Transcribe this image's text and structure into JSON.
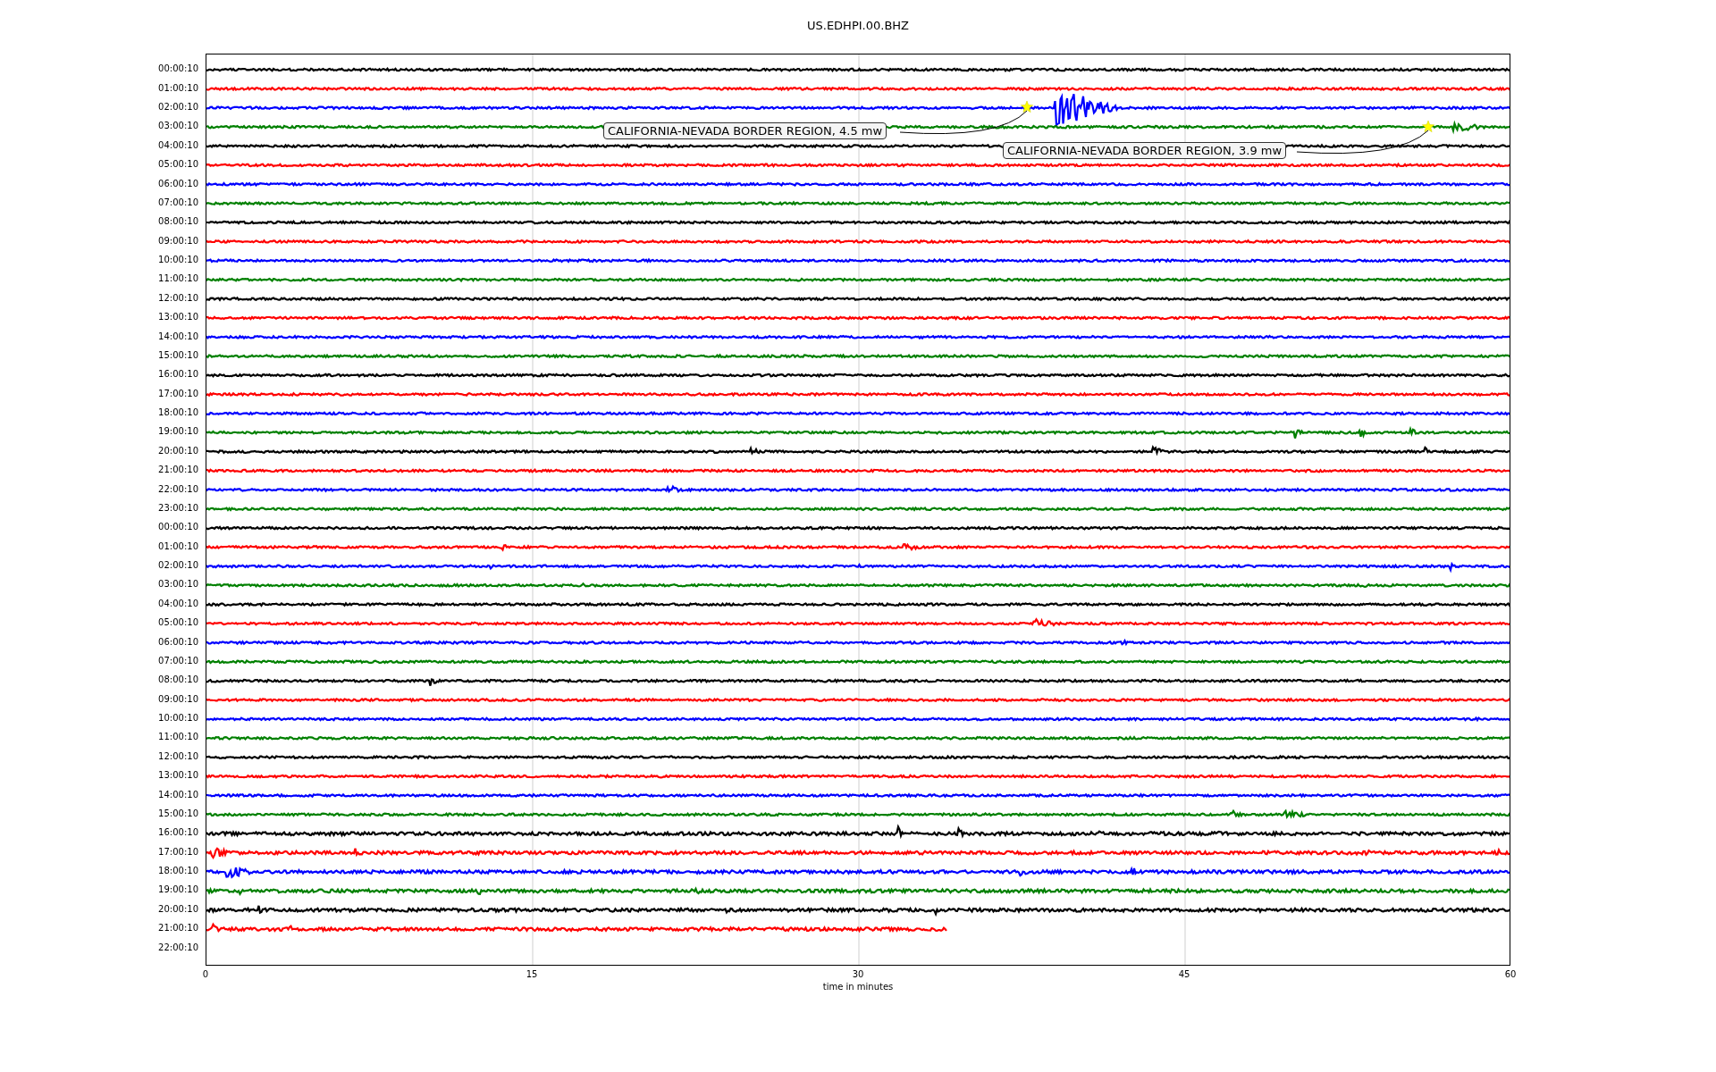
{
  "title": "US.EDHPI.00.BHZ",
  "rows": [
    {
      "label": "00:00:10",
      "color": "#000000"
    },
    {
      "label": "01:00:10",
      "color": "#ff0000"
    },
    {
      "label": "02:00:10",
      "color": "#0000ff"
    },
    {
      "label": "03:00:10",
      "color": "#008000"
    },
    {
      "label": "04:00:10",
      "color": "#000000"
    },
    {
      "label": "05:00:10",
      "color": "#ff0000"
    },
    {
      "label": "06:00:10",
      "color": "#0000ff"
    },
    {
      "label": "07:00:10",
      "color": "#008000"
    },
    {
      "label": "08:00:10",
      "color": "#000000"
    },
    {
      "label": "09:00:10",
      "color": "#ff0000"
    },
    {
      "label": "10:00:10",
      "color": "#0000ff"
    },
    {
      "label": "11:00:10",
      "color": "#008000"
    },
    {
      "label": "12:00:10",
      "color": "#000000"
    },
    {
      "label": "13:00:10",
      "color": "#ff0000"
    },
    {
      "label": "14:00:10",
      "color": "#0000ff"
    },
    {
      "label": "15:00:10",
      "color": "#008000"
    },
    {
      "label": "16:00:10",
      "color": "#000000"
    },
    {
      "label": "17:00:10",
      "color": "#ff0000"
    },
    {
      "label": "18:00:10",
      "color": "#0000ff"
    },
    {
      "label": "19:00:10",
      "color": "#008000"
    },
    {
      "label": "20:00:10",
      "color": "#000000"
    },
    {
      "label": "21:00:10",
      "color": "#ff0000"
    },
    {
      "label": "22:00:10",
      "color": "#0000ff"
    },
    {
      "label": "23:00:10",
      "color": "#008000"
    },
    {
      "label": "00:00:10",
      "color": "#000000"
    },
    {
      "label": "01:00:10",
      "color": "#ff0000"
    },
    {
      "label": "02:00:10",
      "color": "#0000ff"
    },
    {
      "label": "03:00:10",
      "color": "#008000"
    },
    {
      "label": "04:00:10",
      "color": "#000000"
    },
    {
      "label": "05:00:10",
      "color": "#ff0000"
    },
    {
      "label": "06:00:10",
      "color": "#0000ff"
    },
    {
      "label": "07:00:10",
      "color": "#008000"
    },
    {
      "label": "08:00:10",
      "color": "#000000"
    },
    {
      "label": "09:00:10",
      "color": "#ff0000"
    },
    {
      "label": "10:00:10",
      "color": "#0000ff"
    },
    {
      "label": "11:00:10",
      "color": "#008000"
    },
    {
      "label": "12:00:10",
      "color": "#000000"
    },
    {
      "label": "13:00:10",
      "color": "#ff0000"
    },
    {
      "label": "14:00:10",
      "color": "#0000ff"
    },
    {
      "label": "15:00:10",
      "color": "#008000"
    },
    {
      "label": "16:00:10",
      "color": "#000000"
    },
    {
      "label": "17:00:10",
      "color": "#ff0000"
    },
    {
      "label": "18:00:10",
      "color": "#0000ff"
    },
    {
      "label": "19:00:10",
      "color": "#008000"
    },
    {
      "label": "20:00:10",
      "color": "#000000"
    },
    {
      "label": "21:00:10",
      "color": "#ff0000",
      "level": 0.568
    },
    {
      "label": "22:00:10"
    }
  ],
  "annotations": [
    {
      "text": "CALIFORNIA-NEVADA BORDER REGION, 4.5 mw"
    },
    {
      "text": "CALIFORNIA-NEVADA BORDER REGION, 3.9 mw"
    }
  ],
  "xticks": [
    "0",
    "15",
    "30",
    "45",
    "60"
  ],
  "xlabel": "time in minutes"
}
